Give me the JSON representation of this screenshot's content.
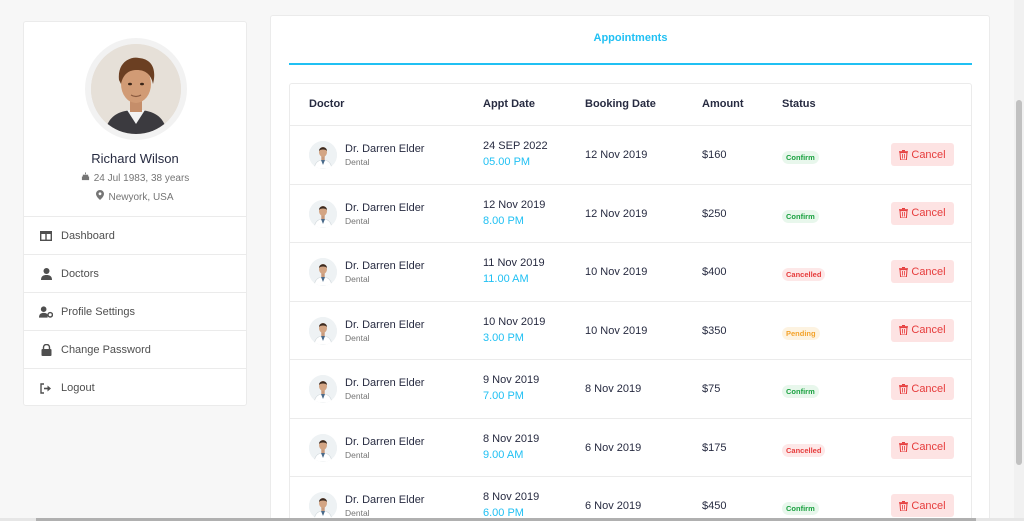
{
  "profile": {
    "name": "Richard Wilson",
    "dob": "24 Jul 1983, 38 years",
    "location": "Newyork, USA"
  },
  "sidebar": {
    "items": [
      {
        "label": "Dashboard",
        "icon": "columns-icon"
      },
      {
        "label": "Doctors",
        "icon": "user-icon"
      },
      {
        "label": "Profile Settings",
        "icon": "user-cog-icon"
      },
      {
        "label": "Change Password",
        "icon": "lock-icon"
      },
      {
        "label": "Logout",
        "icon": "logout-icon"
      }
    ]
  },
  "tabs": {
    "appointments": "Appointments"
  },
  "table": {
    "headers": {
      "doctor": "Doctor",
      "appt_date": "Appt Date",
      "booking_date": "Booking Date",
      "amount": "Amount",
      "status": "Status"
    },
    "cancel_label": "Cancel",
    "rows": [
      {
        "doctor": "Dr. Darren Elder",
        "spec": "Dental",
        "appt_date": "24 SEP 2022",
        "appt_time": "05.00 PM",
        "booking": "12 Nov 2019",
        "amount": "$160",
        "status": "Confirm",
        "status_type": "confirm"
      },
      {
        "doctor": "Dr. Darren Elder",
        "spec": "Dental",
        "appt_date": "12 Nov 2019",
        "appt_time": "8.00 PM",
        "booking": "12 Nov 2019",
        "amount": "$250",
        "status": "Confirm",
        "status_type": "confirm"
      },
      {
        "doctor": "Dr. Darren Elder",
        "spec": "Dental",
        "appt_date": "11 Nov 2019",
        "appt_time": "11.00 AM",
        "booking": "10 Nov 2019",
        "amount": "$400",
        "status": "Cancelled",
        "status_type": "cancelled"
      },
      {
        "doctor": "Dr. Darren Elder",
        "spec": "Dental",
        "appt_date": "10 Nov 2019",
        "appt_time": "3.00 PM",
        "booking": "10 Nov 2019",
        "amount": "$350",
        "status": "Pending",
        "status_type": "pending"
      },
      {
        "doctor": "Dr. Darren Elder",
        "spec": "Dental",
        "appt_date": "9 Nov 2019",
        "appt_time": "7.00 PM",
        "booking": "8 Nov 2019",
        "amount": "$75",
        "status": "Confirm",
        "status_type": "confirm"
      },
      {
        "doctor": "Dr. Darren Elder",
        "spec": "Dental",
        "appt_date": "8 Nov 2019",
        "appt_time": "9.00 AM",
        "booking": "6 Nov 2019",
        "amount": "$175",
        "status": "Cancelled",
        "status_type": "cancelled"
      },
      {
        "doctor": "Dr. Darren Elder",
        "spec": "Dental",
        "appt_date": "8 Nov 2019",
        "appt_time": "6.00 PM",
        "booking": "6 Nov 2019",
        "amount": "$450",
        "status": "Confirm",
        "status_type": "confirm"
      }
    ]
  },
  "colors": {
    "primary": "#20c0f3",
    "confirm": "#1aa140",
    "cancelled": "#e63c3c",
    "pending": "#f3a22a"
  }
}
